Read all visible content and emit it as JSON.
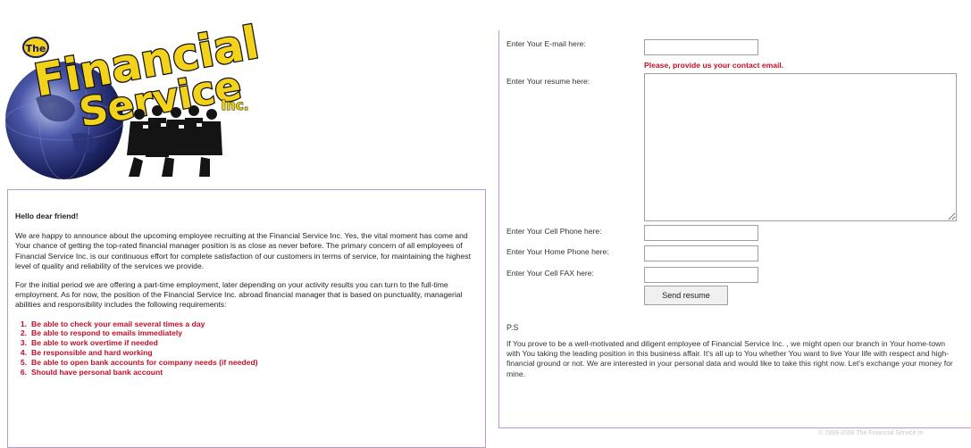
{
  "logo": {
    "word_the": "The",
    "word_financial": "Financial",
    "word_service": "Service",
    "word_inc": "Inc."
  },
  "left_panel": {
    "greeting": "Hello dear friend!",
    "paragraph1": "We are happy to announce about the upcoming employee recruiting at the Financial Service Inc. Yes, the vital moment has come and Your chance of getting the top-rated financial manager position is as close as never before. The primary concern of all employees of Financial Service Inc. is our continuous effort for complete satisfaction of our customers in terms of service, for maintaining the highest level of quality and reliability of the services we provide.",
    "paragraph2": "For the initial period we are offering a part-time employment, later depending on your activity results you can turn to the full-time employment. As for now, the position of the Financial Service Inc. abroad financial manager that is based on punctuality, managerial abilities and responsibility includes the following requirements:",
    "requirements": [
      {
        "num": "1.",
        "text": "Be able to check your email several times a day"
      },
      {
        "num": "2.",
        "text": "Be able to respond to emails immediately"
      },
      {
        "num": "3.",
        "text": "Be able to work overtime if needed"
      },
      {
        "num": "4.",
        "text": "Be responsible and hard working"
      },
      {
        "num": "5.",
        "text": "Be able to open bank accounts for company needs (if needed)"
      },
      {
        "num": "6.",
        "text": "Should have personal bank account"
      }
    ]
  },
  "form": {
    "email_label": "Enter Your E-mail here:",
    "email_value": "",
    "email_error": "Please, provide us your contact email.",
    "resume_label": "Enter Your resume here:",
    "resume_value": "",
    "cell_label": "Enter Your Cell Phone here:",
    "cell_value": "",
    "home_label": "Enter Your Home Phone here:",
    "home_value": "",
    "fax_label": "Enter Your Cell FAX here:",
    "fax_value": "",
    "submit_label": "Send resume"
  },
  "ps": {
    "label": "P.S",
    "text": "If You prove to be a well-motivated and diligent employee of Financial Service Inc. , we might open our branch in Your home-town with You taking the leading position in this business affair. It's all up to You whether You want to live Your life with respect and high-financial ground or not. We are interested in your personal data and would like to take this right now. Let's exchange your money for mine."
  },
  "footer": {
    "copyright": "© 1999-2008 The Financial Service In"
  },
  "colors": {
    "accent_red": "#c0102a",
    "border_purple": "#b79ad2",
    "logo_yellow": "#f3d21b"
  }
}
